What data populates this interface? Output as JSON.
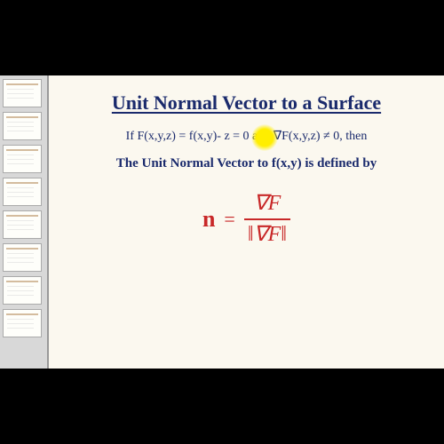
{
  "slide": {
    "title": "Unit Normal Vector to a Surface",
    "condition": "If F(x,y,z) = f(x,y)- z = 0 and ∇F(x,y,z) ≠ 0, then",
    "definition": "The Unit Normal Vector to f(x,y) is defined by",
    "formula": {
      "lhs": "n",
      "eq": "=",
      "numerator": "∇F",
      "denominator": "‖∇F‖"
    }
  },
  "colors": {
    "text_primary": "#1a2a6c",
    "formula": "#c82828",
    "highlight": "#ffee00",
    "slide_bg": "#fbf8ef"
  }
}
